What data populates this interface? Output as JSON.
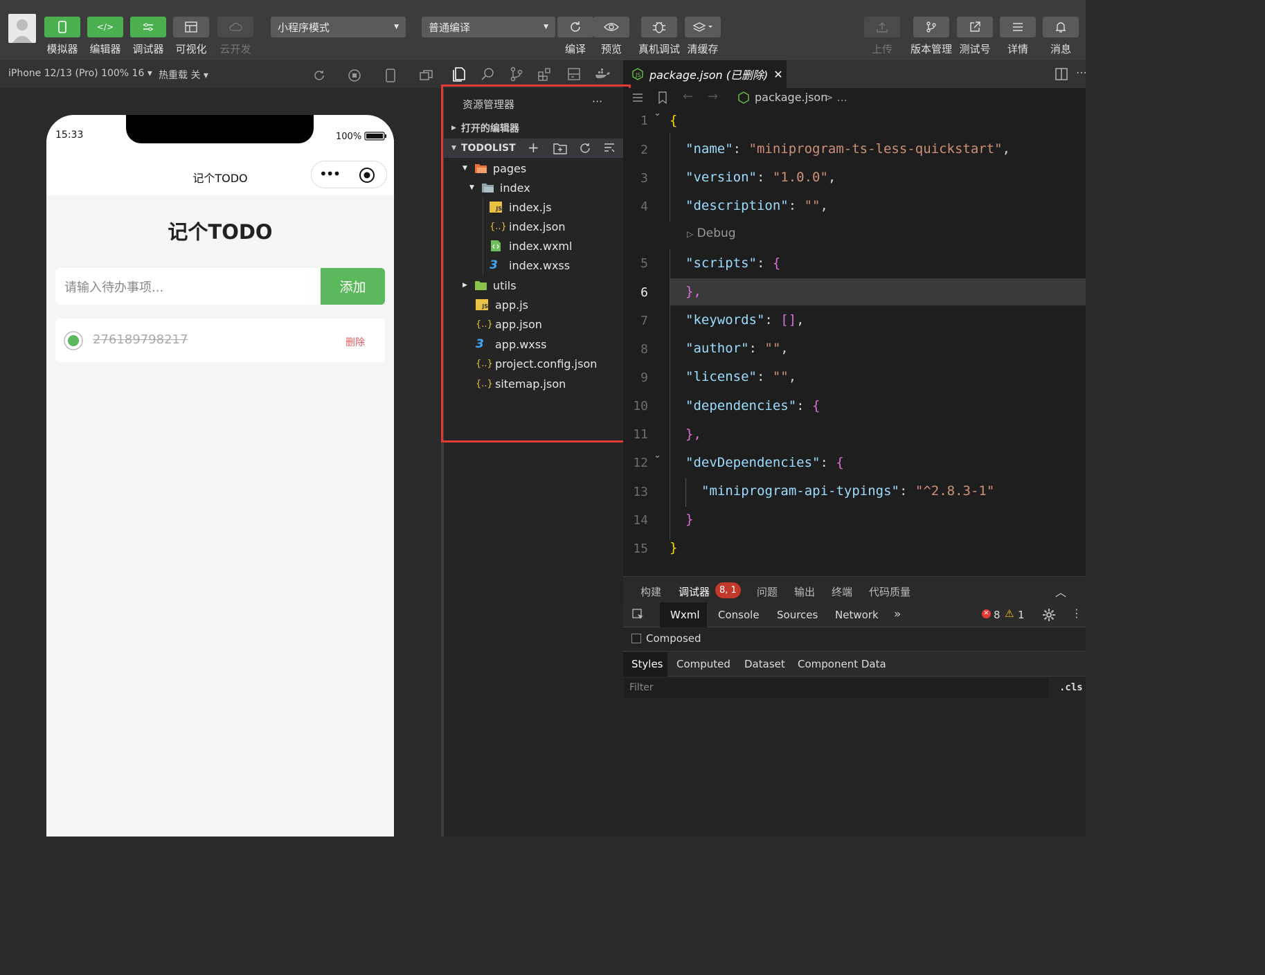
{
  "toolbar": {
    "simulator": "模拟器",
    "editor": "编辑器",
    "debugger": "调试器",
    "visual": "可视化",
    "cloud": "云开发",
    "mode": "小程序模式",
    "compile_mode": "普通编译",
    "compile": "编译",
    "preview": "预览",
    "device_debug": "真机调试",
    "clear_cache": "清缓存",
    "upload": "上传",
    "version": "版本管理",
    "test_account": "测试号",
    "details": "详情",
    "messages": "消息"
  },
  "sim_bar": {
    "device": "iPhone 12/13 (Pro) 100% 16",
    "hot_reload": "热重载 关"
  },
  "phone": {
    "time": "15:33",
    "battery": "100%",
    "nav_title": "记个TODO",
    "page_title": "记个TODO",
    "input_placeholder": "请输入待办事项...",
    "add_button": "添加",
    "todo_text": "276189798217",
    "delete": "删除"
  },
  "explorer": {
    "title": "资源管理器",
    "more": "···",
    "open_editors": "打开的编辑器",
    "project": "TODOLIST",
    "files": [
      {
        "name": "pages"
      },
      {
        "name": "index"
      },
      {
        "name": "index.js"
      },
      {
        "name": "index.json"
      },
      {
        "name": "index.wxml"
      },
      {
        "name": "index.wxss"
      },
      {
        "name": "utils"
      },
      {
        "name": "app.js"
      },
      {
        "name": "app.json"
      },
      {
        "name": "app.wxss"
      },
      {
        "name": "project.config.json"
      },
      {
        "name": "sitemap.json"
      }
    ]
  },
  "editor": {
    "tab": "package.json (已删除)",
    "breadcrumb": "package.json",
    "breadcrumb_more": "> ...",
    "debug_lens": "Debug",
    "line_numbers": [
      "1",
      "2",
      "3",
      "4",
      "5",
      "6",
      "7",
      "8",
      "9",
      "10",
      "11",
      "12",
      "13",
      "14",
      "15"
    ],
    "lines": {
      "l1": "{",
      "l2_key": "\"name\"",
      "l2_val": "\"miniprogram-ts-less-quickstart\"",
      "l3_key": "\"version\"",
      "l3_val": "\"1.0.0\"",
      "l4_key": "\"description\"",
      "l4_val": "\"\"",
      "l5_key": "\"scripts\"",
      "l6": "},",
      "l7_key": "\"keywords\"",
      "l7_val": "[]",
      "l8_key": "\"author\"",
      "l8_val": "\"\"",
      "l9_key": "\"license\"",
      "l9_val": "\"\"",
      "l10_key": "\"dependencies\"",
      "l11": "},",
      "l12_key": "\"devDependencies\"",
      "l13_key": "\"miniprogram-api-typings\"",
      "l13_val": "\"^2.8.3-1\"",
      "l14": "}",
      "l15": "}"
    }
  },
  "devtools": {
    "tabs": [
      "构建",
      "调试器",
      "问题",
      "输出",
      "终端",
      "代码质量"
    ],
    "badge": "8, 1",
    "subtabs": [
      "Wxml",
      "Console",
      "Sources",
      "Network"
    ],
    "errors": "8",
    "warnings": "1",
    "composed": "Composed",
    "style_tabs": [
      "Styles",
      "Computed",
      "Dataset",
      "Component Data"
    ],
    "filter_placeholder": "Filter",
    "cls": ".cls"
  },
  "colors": {
    "accent_green": "#4caf50",
    "highlight_red": "#e53935"
  }
}
